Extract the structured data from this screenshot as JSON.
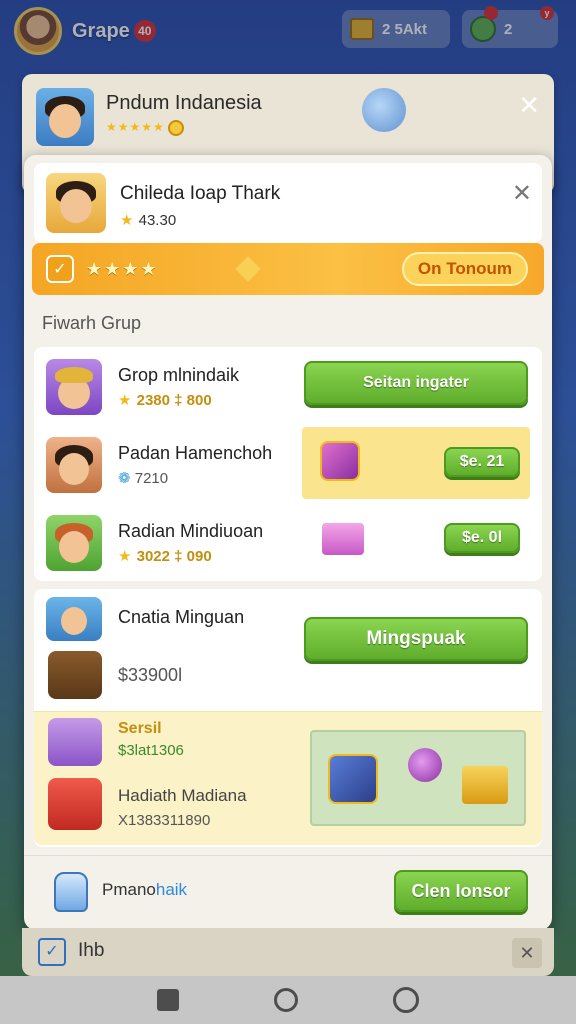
{
  "topbar": {
    "app_name": "Grape",
    "badge": "40",
    "coins_text": "2 5Akt",
    "friends_text": "2",
    "coins_dot": "",
    "friends_dot": "y"
  },
  "back_dialog": {
    "title": "Pndum Indanesia",
    "stars": "★★★★★",
    "close": "✕"
  },
  "dialog": {
    "header": {
      "title": "Chileda Ioap Thark",
      "score": "43.30",
      "star": "★",
      "close": "✕"
    },
    "promo": {
      "check": "✓",
      "stars": "★★★★",
      "button_label": "On Tonoum"
    },
    "section_title": "Fiwarh Grup",
    "rows": [
      {
        "name": "Grop mlnindaik",
        "score_prefix": "★",
        "score": "2380 ‡ 800",
        "button_label": "Seitan ingater"
      },
      {
        "name": "Padan Hamenchoh",
        "score_prefix": "❁",
        "score": "7210",
        "button_label": "$e. 21"
      },
      {
        "name": "Radian Mindiuoan",
        "score_prefix": "★",
        "score": "3022 ‡ 090",
        "button_label": "$e. 0l"
      }
    ],
    "card2": {
      "title": "Cnatia Minguan",
      "amount": "$33900l",
      "button_label": "Mingspuak",
      "bonus_label": "Sersil",
      "bonus_value": "$3lat1306",
      "gift_title": "Hadiath Madiana",
      "gift_value": "X1383311890"
    },
    "footer": {
      "brand_prefix": "Pmano",
      "brand_suffix": "haik",
      "button_label": "Clen Ionsor"
    }
  },
  "under_strip": {
    "check": "✓",
    "label": "Ihb",
    "close": "✕"
  },
  "colors": {
    "accent_green": "#5fae2c",
    "promo_orange": "#f5a523",
    "star_gold": "#f2b91c"
  }
}
